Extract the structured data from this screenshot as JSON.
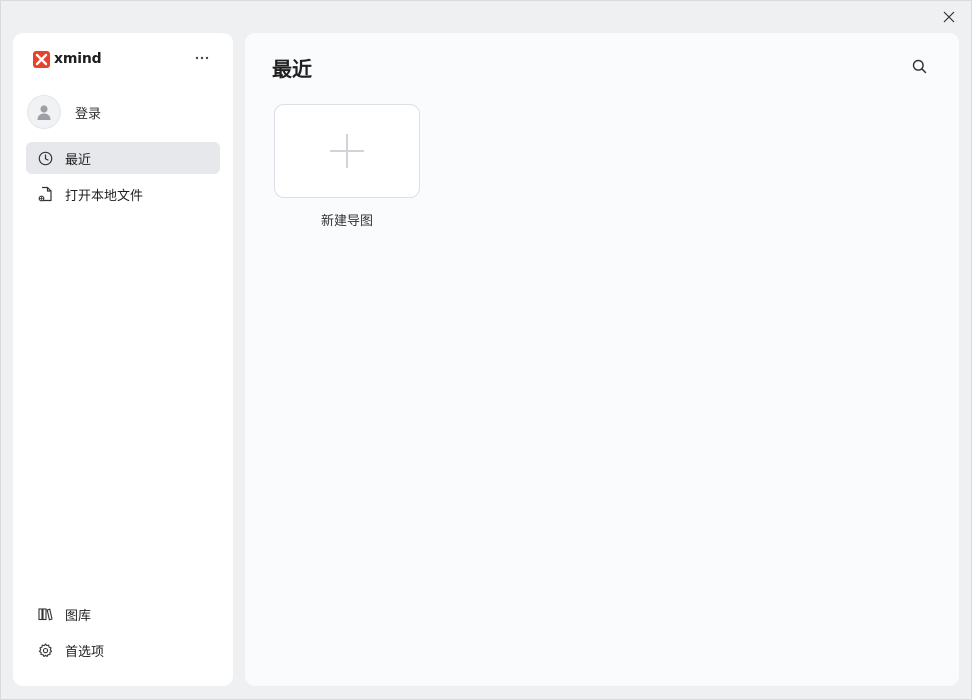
{
  "app": {
    "brand_name": "xmind",
    "brand_color": "#e8412c"
  },
  "window": {
    "close_icon": "close-icon"
  },
  "sidebar": {
    "more_icon": "more-horizontal-icon",
    "account": {
      "label": "登录",
      "icon": "user-icon"
    },
    "nav": [
      {
        "label": "最近",
        "icon": "clock-icon",
        "active": true
      },
      {
        "label": "打开本地文件",
        "icon": "open-file-icon",
        "active": false
      }
    ],
    "footer": [
      {
        "label": "图库",
        "icon": "library-icon"
      },
      {
        "label": "首选项",
        "icon": "gear-icon"
      }
    ]
  },
  "main": {
    "title": "最近",
    "search_icon": "search-icon",
    "new_card": {
      "label": "新建导图",
      "icon": "plus-icon"
    }
  },
  "colors": {
    "window_bg": "#eef0f2",
    "panel_bg": "#ffffff",
    "main_bg": "#fafbfc",
    "active_bg": "#e6e8eb",
    "plus_color": "#d0d3d7"
  }
}
